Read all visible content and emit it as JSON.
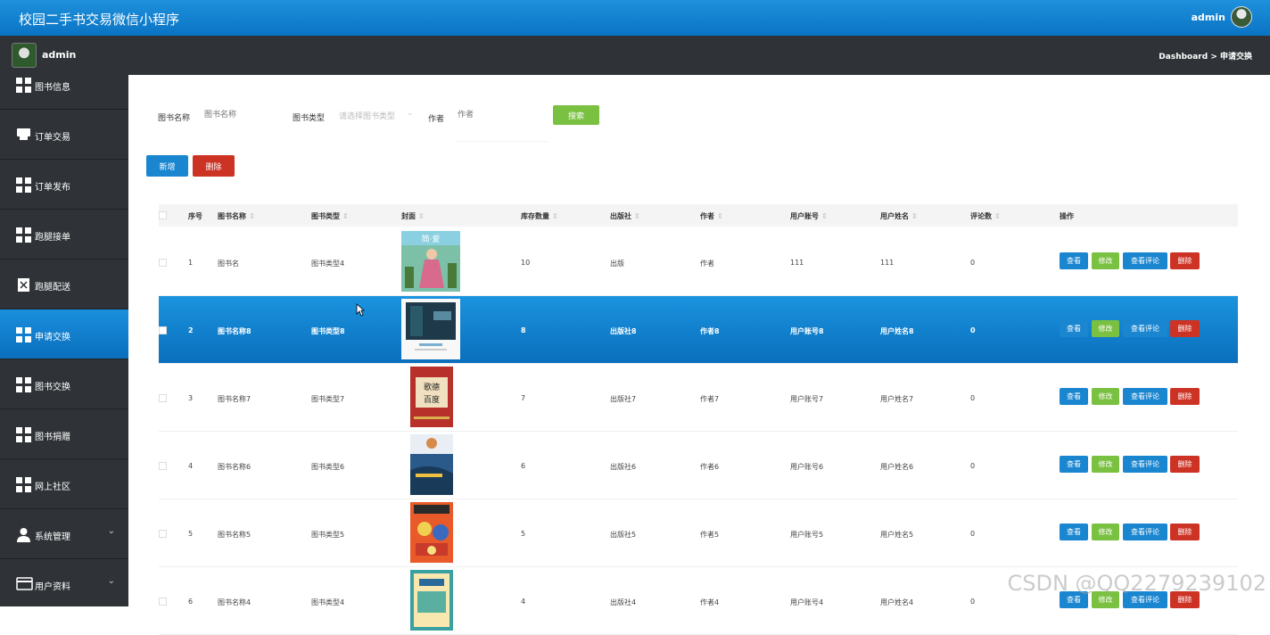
{
  "app": {
    "title": "校园二手书交易微信小程序",
    "user": "admin"
  },
  "subbar": {
    "user": "admin",
    "breadcrumb": "Dashboard > 申请交换"
  },
  "sidebar": {
    "items": [
      {
        "label": "图书信息",
        "icon": "grid-icon"
      },
      {
        "label": "订单交易",
        "icon": "store-icon"
      },
      {
        "label": "订单发布",
        "icon": "grid-icon"
      },
      {
        "label": "跑腿接单",
        "icon": "grid-icon"
      },
      {
        "label": "跑腿配送",
        "icon": "clipboard-icon"
      },
      {
        "label": "申请交换",
        "icon": "grid-icon",
        "active": true
      },
      {
        "label": "图书交换",
        "icon": "grid-icon"
      },
      {
        "label": "图书捐赠",
        "icon": "grid-icon"
      },
      {
        "label": "网上社区",
        "icon": "grid-icon"
      },
      {
        "label": "系统管理",
        "icon": "user-icon",
        "chevron": "⌄"
      },
      {
        "label": "用户资料",
        "icon": "card-icon",
        "chevron": "⌄"
      }
    ]
  },
  "search": {
    "name_label": "图书名称",
    "name_placeholder": "图书名称",
    "type_label": "图书类型",
    "type_placeholder": "请选择图书类型",
    "author_label": "作者",
    "author_placeholder": "作者",
    "search_button": "搜索"
  },
  "actions": {
    "add": "新增",
    "delete": "删除"
  },
  "table": {
    "headers": [
      "序号",
      "图书名称",
      "图书类型",
      "封面",
      "库存数量",
      "出版社",
      "作者",
      "用户账号",
      "用户姓名",
      "评论数",
      "操作"
    ],
    "row_actions": {
      "view": "查看",
      "edit": "修改",
      "comments": "查看评论",
      "delete": "删除"
    },
    "rows": [
      {
        "no": "1",
        "name": "图书名",
        "type": "图书类型4",
        "stock": "10",
        "publisher": "出版",
        "author": "作者",
        "account": "111",
        "username": "111",
        "comments": "0"
      },
      {
        "no": "2",
        "name": "图书名称8",
        "type": "图书类型8",
        "stock": "8",
        "publisher": "出版社8",
        "author": "作者8",
        "account": "用户账号8",
        "username": "用户姓名8",
        "comments": "0",
        "selected": true
      },
      {
        "no": "3",
        "name": "图书名称7",
        "type": "图书类型7",
        "stock": "7",
        "publisher": "出版社7",
        "author": "作者7",
        "account": "用户账号7",
        "username": "用户姓名7",
        "comments": "0"
      },
      {
        "no": "4",
        "name": "图书名称6",
        "type": "图书类型6",
        "stock": "6",
        "publisher": "出版社6",
        "author": "作者6",
        "account": "用户账号6",
        "username": "用户姓名6",
        "comments": "0"
      },
      {
        "no": "5",
        "name": "图书名称5",
        "type": "图书类型5",
        "stock": "5",
        "publisher": "出版社5",
        "author": "作者5",
        "account": "用户账号5",
        "username": "用户姓名5",
        "comments": "0"
      },
      {
        "no": "6",
        "name": "图书名称4",
        "type": "图书类型4",
        "stock": "4",
        "publisher": "出版社4",
        "author": "作者4",
        "account": "用户账号4",
        "username": "用户姓名4",
        "comments": "0"
      }
    ]
  },
  "watermark": "CSDN @QQ2279239102",
  "colors": {
    "primary": "#0a74c4",
    "sidebar": "#2f3337",
    "green": "#7ac142",
    "red": "#cc3325"
  }
}
